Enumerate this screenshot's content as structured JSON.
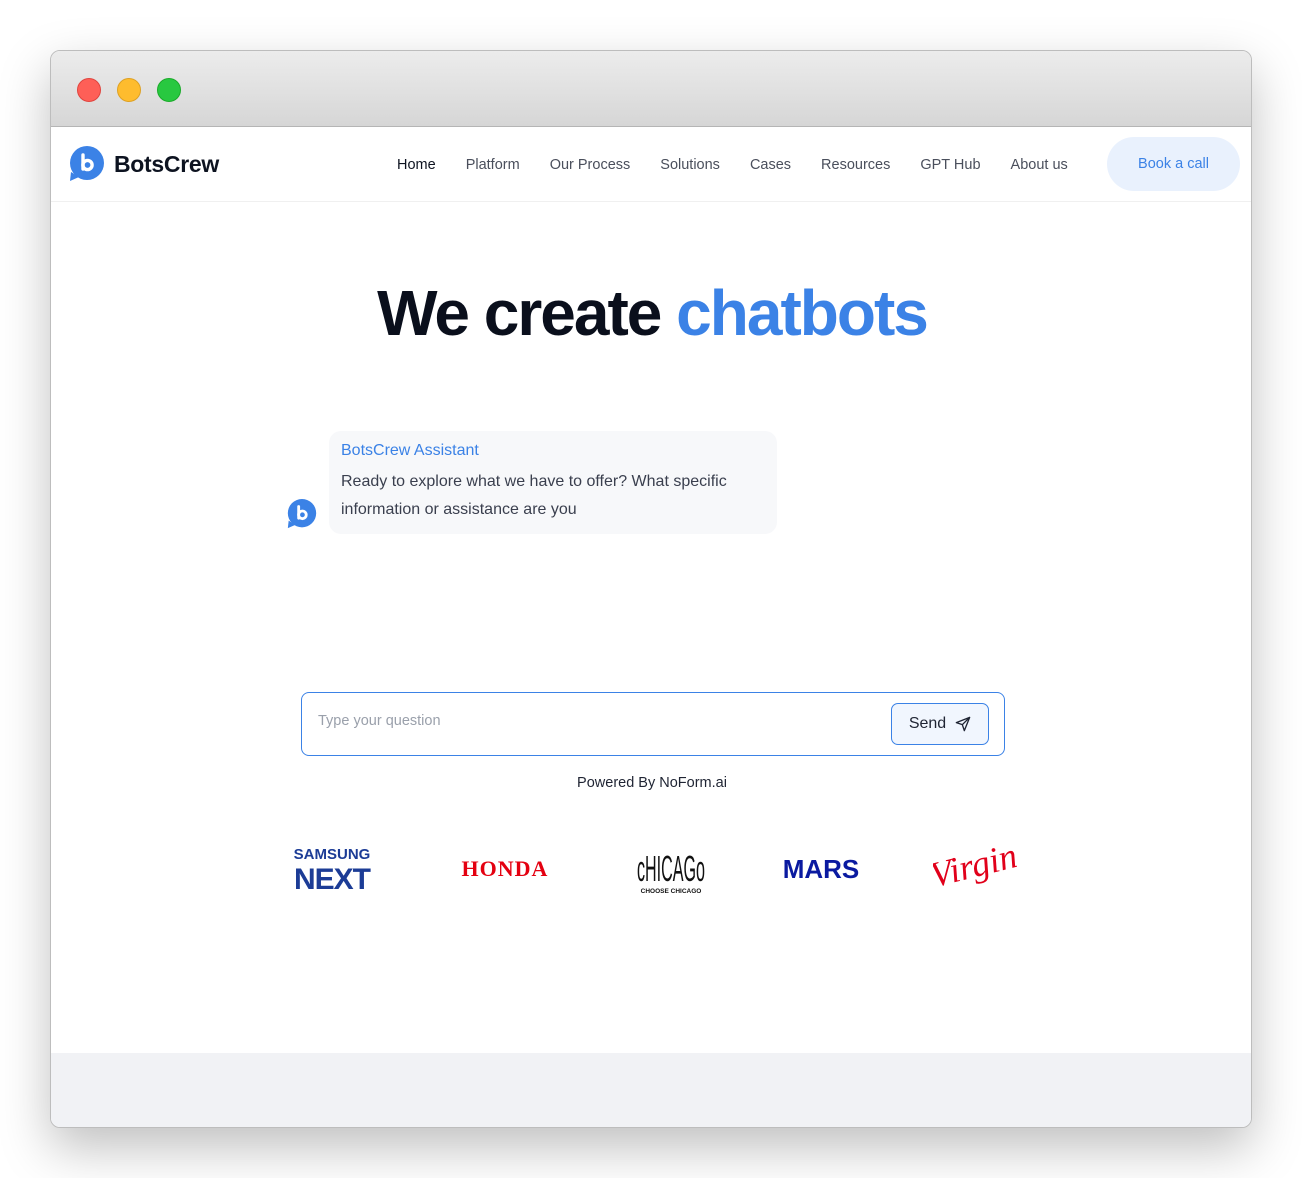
{
  "window": {
    "controls": [
      "close",
      "minimize",
      "zoom"
    ],
    "colors": {
      "close": "#fe5f57",
      "minimize": "#febc2e",
      "zoom": "#28c840"
    }
  },
  "nav": {
    "brand": "BotsCrew",
    "items": [
      {
        "label": "Home",
        "active": true
      },
      {
        "label": "Platform"
      },
      {
        "label": "Our Process"
      },
      {
        "label": "Solutions"
      },
      {
        "label": "Cases"
      },
      {
        "label": "Resources"
      },
      {
        "label": "GPT Hub"
      },
      {
        "label": "About us"
      }
    ],
    "cta": "Book a call"
  },
  "hero": {
    "title_plain": "We create",
    "title_highlight": "chatbots",
    "accent": "#3b82e6"
  },
  "chat": {
    "sender": "BotsCrew Assistant",
    "message": "Ready to explore what we have to offer? What specific information or assistance are you"
  },
  "input": {
    "placeholder": "Type your question",
    "value": "",
    "send_label": "Send",
    "send_icon": "paper-plane-icon"
  },
  "powered_by": "Powered By NoForm.ai",
  "clients": [
    {
      "name": "Samsung Next",
      "lines": [
        "SAMSUNG",
        "NEXT"
      ],
      "color": "#1c3c96"
    },
    {
      "name": "Honda",
      "lines": [
        "HONDA"
      ],
      "color": "#e40010"
    },
    {
      "name": "Chicago",
      "lines": [
        "cHICAGo",
        "CHOOSE CHICAGO"
      ],
      "color": "#111111"
    },
    {
      "name": "Mars",
      "lines": [
        "MARS"
      ],
      "color": "#0a1aa0"
    },
    {
      "name": "Virgin",
      "lines": [
        "Virgin"
      ],
      "color": "#e1001a"
    }
  ]
}
